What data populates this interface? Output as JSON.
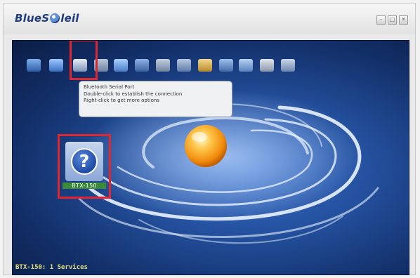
{
  "window": {
    "brand": {
      "prefix": "BlueS",
      "suffix": "leil"
    },
    "controls": {
      "minimize": "-",
      "maximize": "□",
      "close": "✕"
    }
  },
  "toolbar": {
    "icons": [
      "network-access-icon",
      "dialup-icon",
      "serial-port-icon",
      "file-transfer-icon",
      "pim-sync-icon",
      "lan-access-icon",
      "fax-icon",
      "object-push-icon",
      "folder-share-icon",
      "headset-icon",
      "audio-icon",
      "personal-area-icon",
      "printer-icon"
    ],
    "selected_index": 2
  },
  "tooltip": {
    "title": "Bluetooth Serial Port",
    "line1": "Double-click to establish the connection",
    "line2": "Right-click to get more options"
  },
  "device": {
    "name": "BTX-150",
    "icon": "unknown-device-icon"
  },
  "status": {
    "text": "BTX-150: 1 Services"
  },
  "colors": {
    "highlight": "#e0262e",
    "status_text": "#e3e07a",
    "brand": "#1f3c7e"
  }
}
